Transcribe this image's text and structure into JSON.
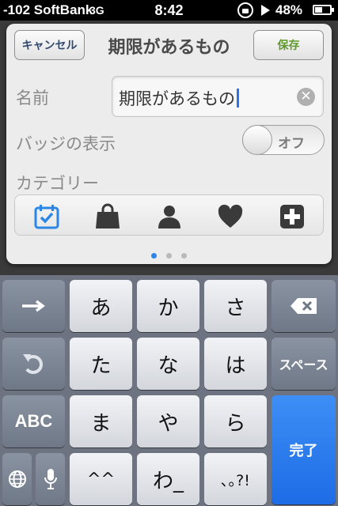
{
  "status_bar": {
    "carrier": "-102 SoftBank",
    "network": "3G",
    "time": "8:42",
    "battery_percent": "48%"
  },
  "dialog": {
    "cancel_label": "キャンセル",
    "title": "期限があるもの",
    "save_label": "保存",
    "name_label": "名前",
    "name_value": "期限があるもの",
    "badge_label": "バッジの表示",
    "badge_toggle_label": "オフ",
    "badge_toggle_on": false,
    "category_label": "カテゴリー",
    "categories": [
      "calendar-icon",
      "shopping-bag-icon",
      "person-icon",
      "heart-icon",
      "plus-icon"
    ],
    "selected_category": 0,
    "page_count": 3,
    "current_page": 0
  },
  "keyboard": {
    "row1": [
      "あ",
      "か",
      "さ"
    ],
    "row2": [
      "た",
      "な",
      "は"
    ],
    "row3": [
      "ま",
      "や",
      "ら"
    ],
    "row4": [
      "^^",
      "わ_",
      "､｡?!"
    ],
    "abc_label": "ABC",
    "space_label": "スペース",
    "done_label": "完了"
  },
  "colors": {
    "accent_blue": "#2b86e6",
    "save_green": "#5d9a2a",
    "done_blue": "#1e6ce6"
  }
}
